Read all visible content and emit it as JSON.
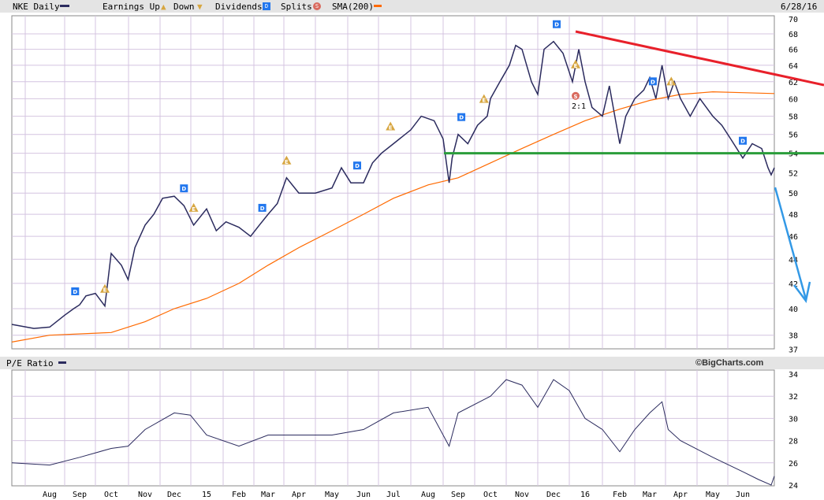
{
  "header": {
    "symbol_label": "NKE Daily",
    "earnings_label": "Earnings Up",
    "down_label": "Down",
    "dividends_label": "Dividends",
    "splits_label": "Splits",
    "sma_label": "SMA(200)",
    "date": "6/28/16"
  },
  "pe_panel": {
    "label": "P/E Ratio",
    "brand": "©BigCharts.com"
  },
  "colors": {
    "price": "#2b2b5e",
    "sma": "#ff6a00",
    "trend": "#e8202a",
    "support": "#2a9d3a",
    "arrow": "#3399e6",
    "dividend": "#2277ee",
    "earnings": "#d7a640",
    "split": "#d96a5e",
    "grid": "#d4c4e0"
  },
  "chart_data": [
    {
      "type": "line",
      "title": "NKE Daily",
      "scale": "log",
      "ylim": [
        37,
        70
      ],
      "x_unit": "months since Aug 2014",
      "x_tick_labels": [
        "Aug",
        "Sep",
        "Oct",
        "Nov",
        "Dec",
        "15",
        "Feb",
        "Mar",
        "Apr",
        "May",
        "Jun",
        "Jul",
        "Aug",
        "Sep",
        "Oct",
        "Nov",
        "Dec",
        "16",
        "Feb",
        "Mar",
        "Apr",
        "May",
        "Jun"
      ],
      "y_tick_labels": [
        "70",
        "68",
        "66",
        "64",
        "62",
        "60",
        "58",
        "56",
        "54",
        "52",
        "50",
        "48",
        "46",
        "44",
        "42",
        "40",
        "38",
        "37"
      ],
      "series": [
        {
          "name": "NKE",
          "points": [
            [
              -1.2,
              38.8
            ],
            [
              -0.5,
              38.5
            ],
            [
              0,
              38.6
            ],
            [
              0.5,
              39.5
            ],
            [
              0.8,
              40
            ],
            [
              1,
              40.3
            ],
            [
              1.2,
              41
            ],
            [
              1.5,
              41.2
            ],
            [
              1.8,
              40.2
            ],
            [
              2,
              44.5
            ],
            [
              2.3,
              43.5
            ],
            [
              2.5,
              42.3
            ],
            [
              2.7,
              45
            ],
            [
              3,
              47
            ],
            [
              3.3,
              48
            ],
            [
              3.6,
              49.5
            ],
            [
              4,
              49.7
            ],
            [
              4.3,
              48.8
            ],
            [
              4.6,
              47
            ],
            [
              5,
              48.5
            ],
            [
              5.3,
              46.5
            ],
            [
              5.6,
              47.3
            ],
            [
              6,
              46.8
            ],
            [
              6.4,
              46
            ],
            [
              6.7,
              47
            ],
            [
              7,
              48
            ],
            [
              7.3,
              49
            ],
            [
              7.6,
              51.5
            ],
            [
              8,
              50
            ],
            [
              8.5,
              50
            ],
            [
              9,
              50.5
            ],
            [
              9.3,
              52.5
            ],
            [
              9.6,
              51
            ],
            [
              10,
              51
            ],
            [
              10.3,
              53
            ],
            [
              10.6,
              54
            ],
            [
              11,
              55
            ],
            [
              11.5,
              56.5
            ],
            [
              11.8,
              58
            ],
            [
              12.2,
              57.5
            ],
            [
              12.5,
              55.5
            ],
            [
              12.7,
              51
            ],
            [
              12.8,
              53.5
            ],
            [
              13,
              56
            ],
            [
              13.3,
              55
            ],
            [
              13.6,
              57
            ],
            [
              13.9,
              58
            ],
            [
              14,
              60
            ],
            [
              14.3,
              62
            ],
            [
              14.6,
              64
            ],
            [
              14.8,
              66.5
            ],
            [
              15,
              66
            ],
            [
              15.3,
              62
            ],
            [
              15.5,
              60.5
            ],
            [
              15.7,
              66
            ],
            [
              16,
              67
            ],
            [
              16.3,
              65.5
            ],
            [
              16.6,
              62
            ],
            [
              16.8,
              66
            ],
            [
              17,
              62
            ],
            [
              17.2,
              59
            ],
            [
              17.5,
              58
            ],
            [
              17.7,
              61.5
            ],
            [
              18,
              55
            ],
            [
              18.2,
              58
            ],
            [
              18.5,
              60
            ],
            [
              18.8,
              61
            ],
            [
              19,
              62.5
            ],
            [
              19.2,
              60
            ],
            [
              19.4,
              64
            ],
            [
              19.6,
              60
            ],
            [
              19.8,
              62
            ],
            [
              20,
              60
            ],
            [
              20.3,
              58
            ],
            [
              20.6,
              60
            ],
            [
              20.8,
              59
            ],
            [
              21,
              58
            ],
            [
              21.3,
              57
            ],
            [
              21.6,
              55.5
            ],
            [
              22,
              53.5
            ],
            [
              22.3,
              55
            ],
            [
              22.6,
              54.5
            ],
            [
              22.8,
              52.5
            ],
            [
              22.9,
              51.8
            ],
            [
              23,
              52.5
            ]
          ]
        },
        {
          "name": "SMA(200)",
          "points": [
            [
              -1.2,
              37.5
            ],
            [
              0,
              38
            ],
            [
              2,
              38.2
            ],
            [
              3,
              39
            ],
            [
              4,
              40
            ],
            [
              5,
              40.8
            ],
            [
              6,
              42
            ],
            [
              7,
              43.5
            ],
            [
              8,
              45
            ],
            [
              9,
              46.5
            ],
            [
              10,
              48
            ],
            [
              11,
              49.5
            ],
            [
              12,
              50.8
            ],
            [
              13,
              51.5
            ],
            [
              14,
              53
            ],
            [
              15,
              54.5
            ],
            [
              16,
              56
            ],
            [
              17,
              57.5
            ],
            [
              18,
              58.8
            ],
            [
              19,
              59.8
            ],
            [
              20,
              60.5
            ],
            [
              21,
              60.8
            ],
            [
              22,
              60.7
            ],
            [
              23,
              60.6
            ]
          ]
        }
      ],
      "support_level": 54,
      "events": [
        {
          "type": "D",
          "t": 0.85
        },
        {
          "type": "E",
          "t": 1.8
        },
        {
          "type": "D",
          "t": 4.3
        },
        {
          "type": "E",
          "t": 4.6
        },
        {
          "type": "D",
          "t": 6.8
        },
        {
          "type": "E",
          "t": 7.6
        },
        {
          "type": "D",
          "t": 9.8
        },
        {
          "type": "E",
          "t": 10.9
        },
        {
          "type": "D",
          "t": 13.1
        },
        {
          "type": "E",
          "t": 13.8
        },
        {
          "type": "D",
          "t": 16.1
        },
        {
          "type": "E",
          "t": 16.7
        },
        {
          "type": "S",
          "t": 16.7,
          "label": "2:1"
        },
        {
          "type": "D",
          "t": 19.1
        },
        {
          "type": "E",
          "t": 19.7
        },
        {
          "type": "D",
          "t": 22.0
        }
      ]
    },
    {
      "type": "line",
      "title": "P/E Ratio",
      "ylim": [
        24,
        34
      ],
      "y_tick_labels": [
        "34",
        "32",
        "30",
        "28",
        "26",
        "24"
      ],
      "series": [
        {
          "name": "P/E Ratio",
          "points": [
            [
              -1.2,
              26
            ],
            [
              0,
              25.8
            ],
            [
              1,
              26.5
            ],
            [
              2,
              27.3
            ],
            [
              2.5,
              27.5
            ],
            [
              3,
              29
            ],
            [
              4,
              30.5
            ],
            [
              4.5,
              30.3
            ],
            [
              5,
              28.5
            ],
            [
              6,
              27.5
            ],
            [
              7,
              28.5
            ],
            [
              8,
              28.5
            ],
            [
              9,
              28.5
            ],
            [
              10,
              29
            ],
            [
              11,
              30.5
            ],
            [
              12,
              31
            ],
            [
              12.7,
              27.5
            ],
            [
              13,
              30.5
            ],
            [
              14,
              32
            ],
            [
              14.5,
              33.5
            ],
            [
              15,
              33
            ],
            [
              15.5,
              31
            ],
            [
              16,
              33.5
            ],
            [
              16.5,
              32.5
            ],
            [
              17,
              30
            ],
            [
              17.5,
              29
            ],
            [
              18,
              27
            ],
            [
              18.5,
              29
            ],
            [
              19,
              30.5
            ],
            [
              19.4,
              31.5
            ],
            [
              19.6,
              29
            ],
            [
              20,
              28
            ],
            [
              21,
              26.5
            ],
            [
              22,
              25.2
            ],
            [
              22.5,
              24.5
            ],
            [
              22.9,
              24
            ],
            [
              23,
              24.8
            ]
          ]
        }
      ]
    }
  ]
}
